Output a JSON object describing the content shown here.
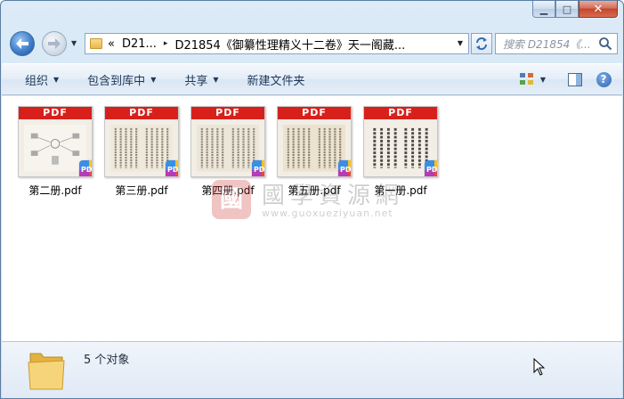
{
  "window": {
    "caption": {
      "minimize": "▁",
      "maximize": "□",
      "close": "✕"
    }
  },
  "nav": {
    "back_icon": "arrow-left-icon",
    "forward_icon": "arrow-right-icon",
    "breadcrumb": {
      "prefix": "«",
      "parent": "D21...",
      "separator": "▸",
      "current": "D21854《御纂性理精义十二卷》天一阁藏..."
    },
    "search_placeholder": "搜索 D21854《..."
  },
  "toolbar": {
    "organize": "组织",
    "include_in_library": "包含到库中",
    "share": "共享",
    "new_folder": "新建文件夹"
  },
  "files": [
    {
      "name": "第二册.pdf",
      "thumb": "diagram"
    },
    {
      "name": "第三册.pdf",
      "thumb": "text"
    },
    {
      "name": "第四册.pdf",
      "thumb": "text"
    },
    {
      "name": "第五册.pdf",
      "thumb": "text"
    },
    {
      "name": "第一册.pdf",
      "thumb": "text-bold"
    }
  ],
  "file_labels": {
    "band": "PDF"
  },
  "watermark": {
    "title": "國學資源網",
    "url": "www.guoxueziyuan.net",
    "seal": "國"
  },
  "details": {
    "count": "5 个对象"
  },
  "colors": {
    "pdf_band": "#d8201b",
    "accent": "#1e395b"
  }
}
